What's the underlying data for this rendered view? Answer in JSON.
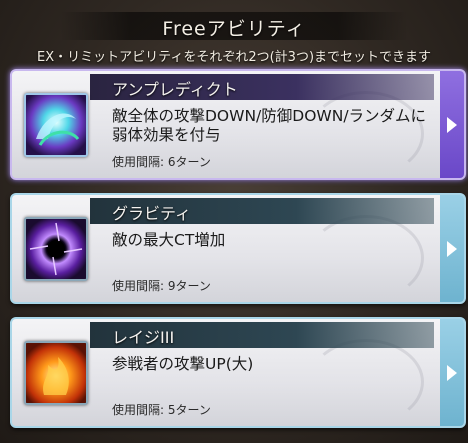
{
  "header": {
    "title": "Freeアビリティ",
    "subtitle": "EX・リミットアビリティをそれぞれ2つ(計3つ)までセットできます"
  },
  "abilities": [
    {
      "name": "アンプレディクト",
      "description": "敵全体の攻撃DOWN/防御DOWN/ランダムに弱体効果を付与",
      "cooldown": "使用間隔: 6ターン",
      "icon": "swirl-debuff-icon",
      "accent": "#7d5ad6",
      "selected": true
    },
    {
      "name": "グラビティ",
      "description": "敵の最大CT増加",
      "cooldown": "使用間隔: 9ターン",
      "icon": "gravity-orb-icon",
      "accent": "#7fc0da",
      "selected": false
    },
    {
      "name": "レイジIII",
      "description": "参戦者の攻撃UP(大)",
      "cooldown": "使用間隔: 5ターン",
      "icon": "rage-fire-icon",
      "accent": "#7fc0da",
      "selected": false
    }
  ]
}
